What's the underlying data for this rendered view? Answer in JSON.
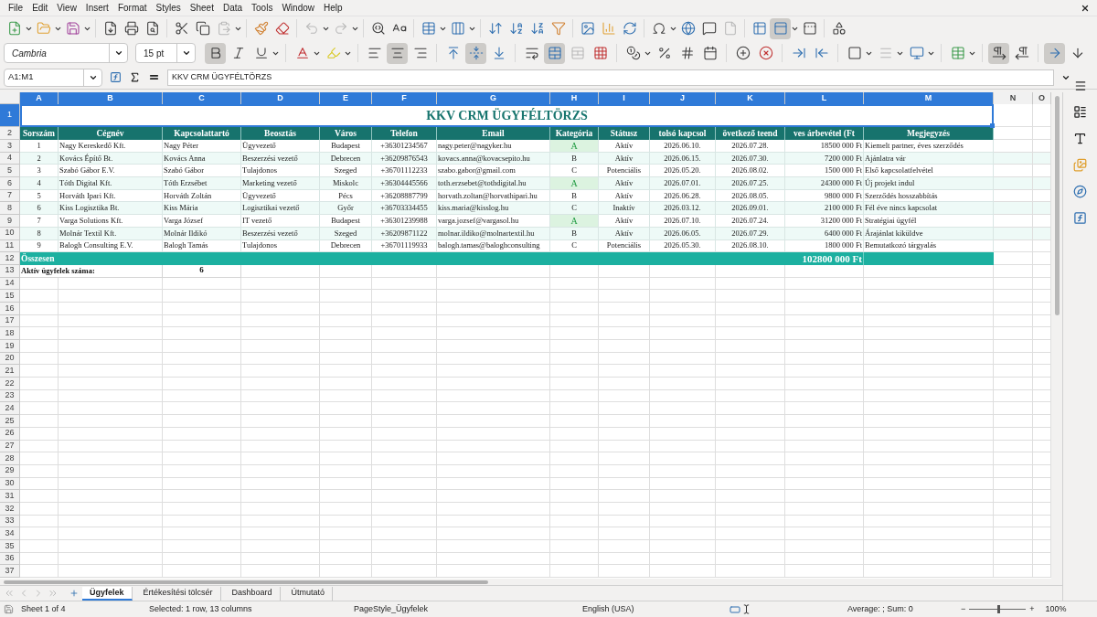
{
  "menu": [
    "File",
    "Edit",
    "View",
    "Insert",
    "Format",
    "Styles",
    "Sheet",
    "Data",
    "Tools",
    "Window",
    "Help"
  ],
  "standard_toolbar": [
    [
      {
        "kind": "new",
        "pressed": false,
        "disabled": false
      },
      {
        "kind": "open",
        "pressed": false,
        "disabled": false
      },
      {
        "kind": "save",
        "pressed": false,
        "disabled": false
      }
    ],
    [
      {
        "kind": "pdf",
        "pressed": false,
        "disabled": false
      },
      {
        "kind": "print",
        "pressed": false,
        "disabled": false
      },
      {
        "kind": "preview",
        "pressed": false,
        "disabled": false
      }
    ],
    [
      {
        "kind": "cut",
        "pressed": false,
        "disabled": false
      },
      {
        "kind": "copy",
        "pressed": false,
        "disabled": false
      },
      {
        "kind": "paste",
        "pressed": false,
        "disabled": true
      }
    ],
    [
      {
        "kind": "clone",
        "pressed": false,
        "disabled": false
      },
      {
        "kind": "clear",
        "pressed": false,
        "disabled": false
      }
    ],
    [
      {
        "kind": "undo",
        "pressed": false,
        "disabled": true
      },
      {
        "kind": "redo",
        "pressed": false,
        "disabled": true
      }
    ],
    [
      {
        "kind": "find",
        "pressed": false,
        "disabled": false
      },
      {
        "kind": "spelling",
        "pressed": false,
        "disabled": false
      }
    ],
    [
      {
        "kind": "row",
        "pressed": false,
        "disabled": false
      },
      {
        "kind": "column",
        "pressed": false,
        "disabled": false
      }
    ],
    [
      {
        "kind": "sort",
        "pressed": false,
        "disabled": false
      },
      {
        "kind": "sortasc",
        "pressed": false,
        "disabled": false
      },
      {
        "kind": "sortdesc",
        "pressed": false,
        "disabled": false
      },
      {
        "kind": "filter",
        "pressed": false,
        "disabled": false
      }
    ],
    [
      {
        "kind": "image",
        "pressed": false,
        "disabled": false
      },
      {
        "kind": "chart",
        "pressed": false,
        "disabled": false
      },
      {
        "kind": "pivot",
        "pressed": false,
        "disabled": false
      }
    ],
    [
      {
        "kind": "special",
        "pressed": false,
        "disabled": false
      },
      {
        "kind": "link",
        "pressed": false,
        "disabled": false
      },
      {
        "kind": "comment",
        "pressed": false,
        "disabled": false
      },
      {
        "kind": "headers",
        "pressed": false,
        "disabled": true
      }
    ],
    [
      {
        "kind": "printrange",
        "pressed": false,
        "disabled": false
      },
      {
        "kind": "freeze",
        "pressed": true,
        "disabled": false
      },
      {
        "kind": "split",
        "pressed": false,
        "disabled": false
      }
    ],
    [
      {
        "kind": "shapes",
        "pressed": false,
        "disabled": false
      }
    ]
  ],
  "formatting_toolbar": {
    "font": "Cambria",
    "size": "15 pt",
    "groups": [
      [
        {
          "kind": "bold",
          "pressed": true,
          "disabled": false
        },
        {
          "kind": "italic",
          "pressed": false,
          "disabled": false
        },
        {
          "kind": "underline",
          "pressed": false,
          "disabled": false
        }
      ],
      [
        {
          "kind": "fontcolor",
          "pressed": false,
          "disabled": false
        },
        {
          "kind": "highlight",
          "pressed": false,
          "disabled": false
        }
      ],
      [
        {
          "kind": "left",
          "pressed": false,
          "disabled": false
        },
        {
          "kind": "center",
          "pressed": true,
          "disabled": false
        },
        {
          "kind": "right",
          "pressed": false,
          "disabled": false
        }
      ],
      [
        {
          "kind": "top",
          "pressed": false,
          "disabled": false
        },
        {
          "kind": "middle",
          "pressed": true,
          "disabled": false
        },
        {
          "kind": "bottom",
          "pressed": false,
          "disabled": false
        }
      ],
      [
        {
          "kind": "wrap",
          "pressed": false,
          "disabled": false
        },
        {
          "kind": "merge",
          "pressed": true,
          "disabled": false
        },
        {
          "kind": "unmerge",
          "pressed": false,
          "disabled": true
        },
        {
          "kind": "mergeall",
          "pressed": false,
          "disabled": false
        }
      ],
      [
        {
          "kind": "currency",
          "pressed": false,
          "disabled": false
        },
        {
          "kind": "percent",
          "pressed": false,
          "disabled": false
        },
        {
          "kind": "number",
          "pressed": false,
          "disabled": false
        },
        {
          "kind": "date",
          "pressed": false,
          "disabled": false
        }
      ],
      [
        {
          "kind": "adddecimal",
          "pressed": false,
          "disabled": false
        },
        {
          "kind": "deldecimal",
          "pressed": false,
          "disabled": false
        }
      ],
      [
        {
          "kind": "indent",
          "pressed": false,
          "disabled": false
        },
        {
          "kind": "outdent",
          "pressed": false,
          "disabled": false
        }
      ],
      [
        {
          "kind": "borders",
          "pressed": false,
          "disabled": false
        },
        {
          "kind": "borderstyle",
          "pressed": false,
          "disabled": true
        },
        {
          "kind": "bordercolor",
          "pressed": false,
          "disabled": false
        }
      ],
      [
        {
          "kind": "conditional",
          "pressed": false,
          "disabled": false
        }
      ],
      [
        {
          "kind": "ltr",
          "pressed": true,
          "disabled": false
        },
        {
          "kind": "rtl",
          "pressed": false,
          "disabled": false
        }
      ],
      [
        {
          "kind": "textltr",
          "pressed": true,
          "disabled": false
        },
        {
          "kind": "texttb",
          "pressed": false,
          "disabled": false
        }
      ]
    ]
  },
  "formula_bar": {
    "name_box": "A1:M1",
    "value": "KKV CRM ÜGYFÉLTÖRZS"
  },
  "columns": [
    {
      "label": "A",
      "selected": true
    },
    {
      "label": "B",
      "selected": true
    },
    {
      "label": "C",
      "selected": true
    },
    {
      "label": "D",
      "selected": true
    },
    {
      "label": "E",
      "selected": true
    },
    {
      "label": "F",
      "selected": true
    },
    {
      "label": "G",
      "selected": true
    },
    {
      "label": "H",
      "selected": true
    },
    {
      "label": "I",
      "selected": true
    },
    {
      "label": "J",
      "selected": true
    },
    {
      "label": "K",
      "selected": true
    },
    {
      "label": "L",
      "selected": true
    },
    {
      "label": "M",
      "selected": true
    },
    {
      "label": "N",
      "selected": false
    },
    {
      "label": "O",
      "selected": false
    }
  ],
  "rows": [
    {
      "number": "1",
      "selected": true,
      "kind": "title",
      "text": "KKV CRM ÜGYFÉLTÖRZS"
    },
    {
      "number": "2",
      "selected": false,
      "kind": "header",
      "cells": [
        "Sorszám",
        "Cégnév",
        "Kapcsolattartó",
        "Beosztás",
        "Város",
        "Telefon",
        "Email",
        "Kategória",
        "Státusz",
        "tolsó kapcsol",
        "övetkező teend",
        "ves árbevétel (Ft",
        "Megjegyzés"
      ]
    },
    {
      "number": "3",
      "selected": false,
      "kind": "data",
      "highlight": true,
      "cells": [
        "1",
        "Nagy Kereskedő Kft.",
        "Nagy Péter",
        "Ügyvezető",
        "Budapest",
        "+36301234567",
        "nagy.peter@nagyker.hu",
        "A",
        "Aktív",
        "2026.06.10.",
        "2026.07.28.",
        "18500 000 Ft",
        "Kiemelt partner, éves szerződés"
      ]
    },
    {
      "number": "4",
      "selected": false,
      "kind": "data",
      "highlight": false,
      "cells": [
        "2",
        "Kovács Építő Bt.",
        "Kovács Anna",
        "Beszerzési vezető",
        "Debrecen",
        "+36209876543",
        "kovacs.anna@kovacsepito.hu",
        "B",
        "Aktív",
        "2026.06.15.",
        "2026.07.30.",
        "7200 000 Ft",
        "Ajánlatra vár"
      ]
    },
    {
      "number": "5",
      "selected": false,
      "kind": "data",
      "highlight": false,
      "cells": [
        "3",
        "Szabó Gábor E.V.",
        "Szabó Gábor",
        "Tulajdonos",
        "Szeged",
        "+36701112233",
        "szabo.gabor@gmail.com",
        "C",
        "Potenciális",
        "2026.05.20.",
        "2026.08.02.",
        "1500 000 Ft",
        "Első kapcsolatfelvétel"
      ]
    },
    {
      "number": "6",
      "selected": false,
      "kind": "data",
      "highlight": true,
      "cells": [
        "4",
        "Tóth Digital Kft.",
        "Tóth Erzsébet",
        "Marketing vezető",
        "Miskolc",
        "+36304445566",
        "toth.erzsebet@tothdigital.hu",
        "A",
        "Aktív",
        "2026.07.01.",
        "2026.07.25.",
        "24300 000 Ft",
        "Új projekt indul"
      ]
    },
    {
      "number": "7",
      "selected": false,
      "kind": "data",
      "highlight": false,
      "cells": [
        "5",
        "Horváth Ipari Kft.",
        "Horváth Zoltán",
        "Ügyvezető",
        "Pécs",
        "+36208887799",
        "horvath.zoltan@horvathipari.hu",
        "B",
        "Aktív",
        "2026.06.28.",
        "2026.08.05.",
        "9800 000 Ft",
        "Szerződés hosszabbítás"
      ]
    },
    {
      "number": "8",
      "selected": false,
      "kind": "data",
      "highlight": false,
      "cells": [
        "6",
        "Kiss Logisztika Bt.",
        "Kiss Mária",
        "Logisztikai vezető",
        "Győr",
        "+36703334455",
        "kiss.maria@kisslog.hu",
        "C",
        "Inaktív",
        "2026.03.12.",
        "2026.09.01.",
        "2100 000 Ft",
        "Fél éve nincs kapcsolat"
      ]
    },
    {
      "number": "9",
      "selected": false,
      "kind": "data",
      "highlight": true,
      "cells": [
        "7",
        "Varga Solutions Kft.",
        "Varga József",
        "IT vezető",
        "Budapest",
        "+36301239988",
        "varga.jozsef@vargasol.hu",
        "A",
        "Aktív",
        "2026.07.10.",
        "2026.07.24.",
        "31200 000 Ft",
        "Stratégiai ügyfél"
      ]
    },
    {
      "number": "10",
      "selected": false,
      "kind": "data",
      "highlight": false,
      "cells": [
        "8",
        "Molnár Textil Kft.",
        "Molnár Ildikó",
        "Beszerzési vezető",
        "Szeged",
        "+36209871122",
        "molnar.ildiko@molnartextil.hu",
        "B",
        "Aktív",
        "2026.06.05.",
        "2026.07.29.",
        "6400 000 Ft",
        "Árajánlat kiküldve"
      ]
    },
    {
      "number": "11",
      "selected": false,
      "kind": "data",
      "highlight": false,
      "cells": [
        "9",
        "Balogh Consulting E.V.",
        "Balogh Tamás",
        "Tulajdonos",
        "Debrecen",
        "+36701119933",
        "balogh.tamas@baloghconsulting",
        "C",
        "Potenciális",
        "2026.05.30.",
        "2026.08.10.",
        "1800 000 Ft",
        "Bemutatkozó tárgyalás"
      ]
    },
    {
      "number": "12",
      "selected": false,
      "kind": "total",
      "label": "Összesen",
      "value": "102800 000 Ft"
    },
    {
      "number": "13",
      "selected": false,
      "kind": "count",
      "label": "Aktív ügyfelek száma:",
      "value": "6"
    }
  ],
  "empty_rows": [
    "14",
    "15",
    "16",
    "17",
    "18",
    "19",
    "20",
    "21",
    "22",
    "23",
    "24",
    "25",
    "26",
    "27",
    "28",
    "29",
    "30",
    "31",
    "32",
    "33",
    "34",
    "35",
    "36",
    "37"
  ],
  "sheet_tabs": [
    {
      "label": "Ügyfelek",
      "selected": true
    },
    {
      "label": "Értékesítési tölcsér",
      "selected": false
    },
    {
      "label": "Dashboard",
      "selected": false
    },
    {
      "label": "Útmutató",
      "selected": false
    }
  ],
  "status_bar": {
    "sheet": "Sheet 1 of 4",
    "selection": "Selected: 1 row, 13 columns",
    "page_style": "PageStyle_Ügyfelek",
    "language": "English (USA)",
    "summary": "Average: ; Sum: 0",
    "zoom_out": "−",
    "zoom_in": "+",
    "zoom_slider": {
      "level": 0.5
    },
    "zoom": "100%"
  }
}
